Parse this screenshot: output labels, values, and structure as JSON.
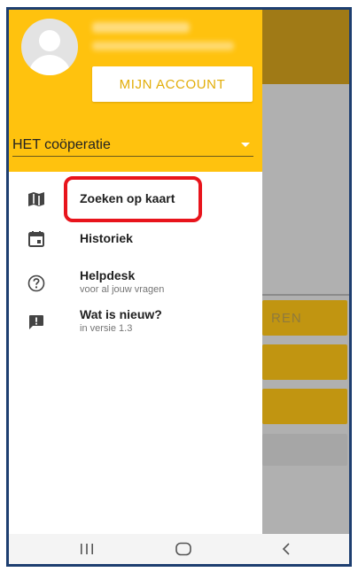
{
  "drawer": {
    "account_button": "MIJN ACCOUNT",
    "cooperation": "HET coöperatie",
    "menu": [
      {
        "title": "Zoeken op kaart",
        "subtitle": "",
        "icon": "map-icon"
      },
      {
        "title": "Historiek",
        "subtitle": "",
        "icon": "calendar-icon"
      },
      {
        "title": "Helpdesk",
        "subtitle": "voor al jouw vragen",
        "icon": "help-circle-icon"
      },
      {
        "title": "Wat is nieuw?",
        "subtitle": "in versie 1.3",
        "icon": "feedback-icon"
      }
    ]
  },
  "background": {
    "button_partial_label": "REN"
  },
  "colors": {
    "accent": "#ffc20e",
    "highlight": "#e8141c",
    "frame": "#1d3e70"
  },
  "navbar": {
    "recents_icon": "recents-icon",
    "home_icon": "home-icon",
    "back_icon": "back-icon"
  }
}
